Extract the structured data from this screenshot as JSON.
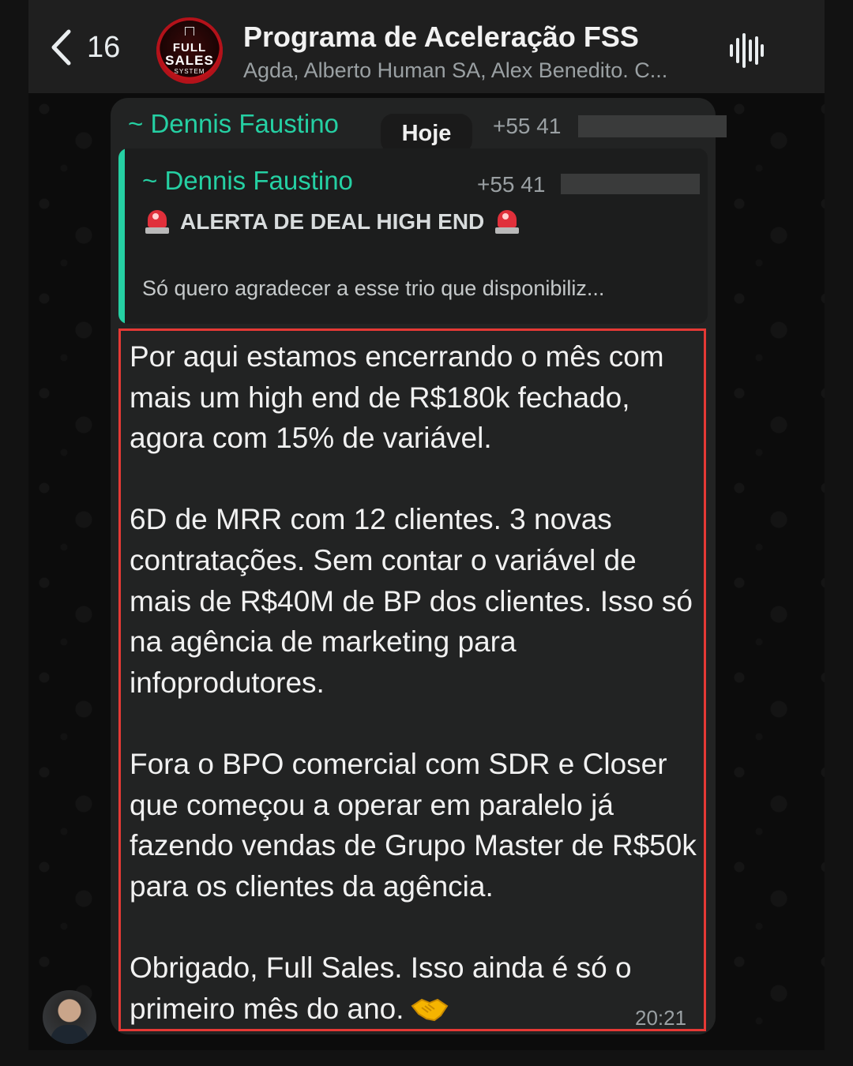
{
  "header": {
    "back_count": "16",
    "group_title": "Programa de Aceleração FSS",
    "group_subtitle": "Agda, Alberto Human SA, Alex Benedito. C...",
    "group_avatar": {
      "line1": "FULL",
      "line2": "SALES",
      "line3": "SYSTEM"
    },
    "icons": {
      "back": "chevron-left-icon",
      "audio": "audio-waveform-icon"
    }
  },
  "date_pill": "Hoje",
  "message": {
    "sender_name": "~ Dennis Faustino",
    "sender_phone": "+55 41",
    "quoted": {
      "sender_name": "~ Dennis Faustino",
      "sender_phone": "+55 41",
      "title": "ALERTA DE DEAL HIGH END",
      "preview": "Só quero agradecer a esse trio que disponibiliz..."
    },
    "paragraphs": [
      "Por aqui estamos encerrando o mês com mais um high end de R$180k fechado, agora com 15% de variável.",
      "6D de MRR com 12 clientes. 3 novas contratações. Sem contar o variável de mais de R$40M de BP dos clientes. Isso só na agência de marketing para infoprodutores.",
      "Fora o BPO comercial com SDR e Closer que começou a operar em paralelo já fazendo vendas de Grupo Master de R$50k para os clientes da agência.",
      "Obrigado, Full Sales. Isso ainda é só o primeiro mês do ano."
    ],
    "time": "20:21"
  },
  "colors": {
    "accent": "#25d0a3",
    "highlight_border": "#e53935",
    "bubble": "#222323"
  }
}
